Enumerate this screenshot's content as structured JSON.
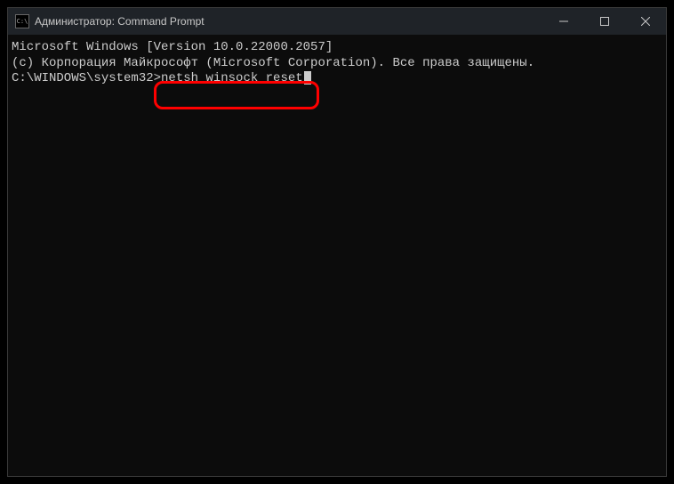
{
  "window": {
    "title": "Администратор: Command Prompt"
  },
  "terminal": {
    "line1": "Microsoft Windows [Version 10.0.22000.2057]",
    "line2": "(c) Корпорация Майкрософт (Microsoft Corporation). Все права защищены.",
    "blank": "",
    "prompt": "C:\\WINDOWS\\system32>",
    "command": "netsh winsock reset"
  }
}
